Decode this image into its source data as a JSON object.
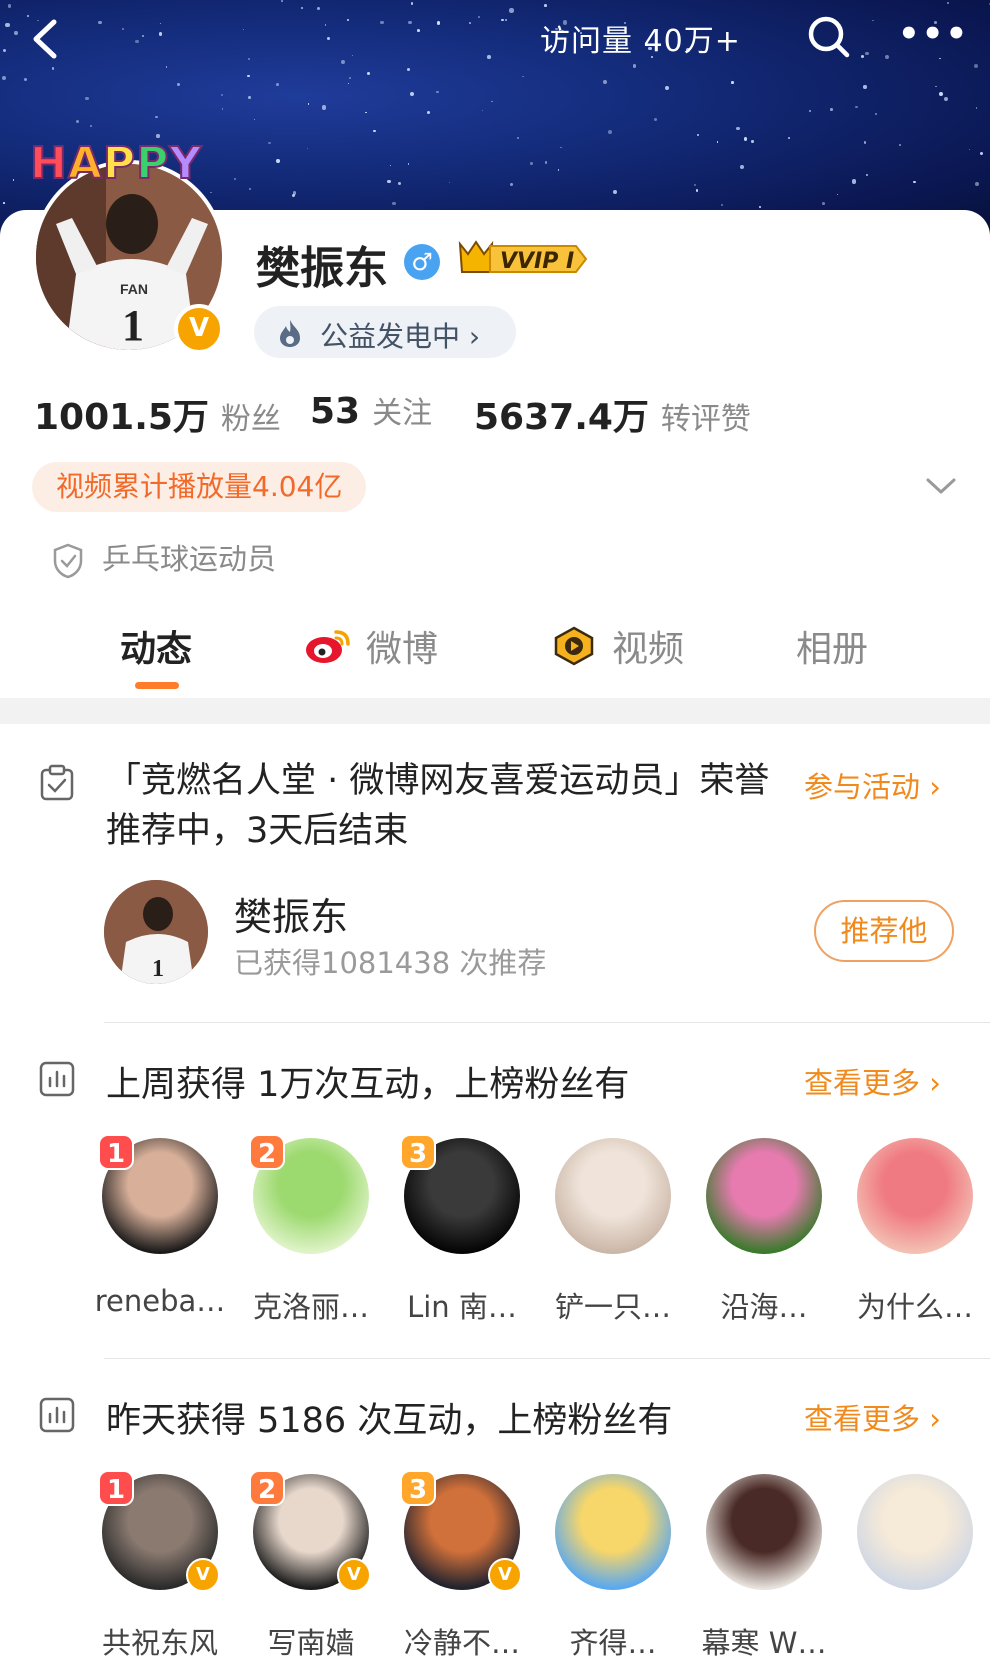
{
  "header": {
    "visits_label": "访问量 40万+",
    "back_label": "",
    "more_label": "•••"
  },
  "profile": {
    "badge_text": "HAPPY",
    "name": "樊振东",
    "gender_symbol": "♂",
    "vip_label": "VVIP I",
    "verify_symbol": "V",
    "charity_label": "公益发电中 ›",
    "stats": [
      {
        "value": "1001.5万",
        "label": "粉丝"
      },
      {
        "value": "53",
        "label": "关注"
      },
      {
        "value": "5637.4万",
        "label": "转评赞"
      }
    ],
    "play_count_label": "视频累计播放量4.04亿",
    "occupation": "乒乓球运动员"
  },
  "tabs": [
    {
      "label": "动态",
      "icon": "none"
    },
    {
      "label": "微博",
      "icon": "weibo-icon"
    },
    {
      "label": "视频",
      "icon": "video-icon"
    },
    {
      "label": "相册",
      "icon": "none"
    }
  ],
  "honor": {
    "title": "「竞燃名人堂 · 微博网友喜爱运动员」荣誉推荐中，3天后结束",
    "action_label": "参与活动 ›",
    "recommend_name": "樊振东",
    "recommend_count": "已获得1081438 次推荐",
    "recommend_button": "推荐他"
  },
  "weekly": {
    "title": "上周获得 1万次互动，上榜粉丝有",
    "more_label": "查看更多 ›",
    "fans": [
      {
        "rank": "1",
        "name": "reneba…",
        "colors": [
          "#1a1a1a",
          "#d8b09a"
        ],
        "verified": false
      },
      {
        "rank": "2",
        "name": "克洛丽…",
        "colors": [
          "#dff3c8",
          "#9cd96e"
        ],
        "verified": false
      },
      {
        "rank": "3",
        "name": "Lin 南…",
        "colors": [
          "#050505",
          "#3a3a3a"
        ],
        "verified": false
      },
      {
        "rank": "",
        "name": "铲一只…",
        "colors": [
          "#cbb7a8",
          "#f0e4da"
        ],
        "verified": false
      },
      {
        "rank": "",
        "name": "沿海…",
        "colors": [
          "#3a7a2c",
          "#e77bb0"
        ],
        "verified": false
      },
      {
        "rank": "",
        "name": "为什么…",
        "colors": [
          "#f3c0b3",
          "#f07a82"
        ],
        "verified": false
      }
    ]
  },
  "yesterday": {
    "title": "昨天获得 5186 次互动，上榜粉丝有",
    "more_label": "查看更多 ›",
    "fans": [
      {
        "rank": "1",
        "name": "共祝东风",
        "colors": [
          "#2a2a2a",
          "#8a7a70"
        ],
        "verified": true
      },
      {
        "rank": "2",
        "name": "写南嫱",
        "colors": [
          "#1c1c1c",
          "#e8d8cc"
        ],
        "verified": true
      },
      {
        "rank": "3",
        "name": "冷静不…",
        "colors": [
          "#20222e",
          "#d0703a"
        ],
        "verified": true
      },
      {
        "rank": "",
        "name": "齐得…",
        "colors": [
          "#5aa8f0",
          "#f7d66a"
        ],
        "verified": false
      },
      {
        "rank": "",
        "name": "幕寒 W…",
        "colors": [
          "#e8e2dc",
          "#4a2a26"
        ],
        "verified": false
      },
      {
        "rank": "",
        "name": "",
        "colors": [
          "#cfd7e4",
          "#f6ead8"
        ],
        "verified": false
      }
    ]
  },
  "colors": {
    "accent_orange": "#f08a1d",
    "rank1": "#ff4d4d",
    "rank2": "#ff7a3d",
    "rank3": "#ffa62b"
  }
}
